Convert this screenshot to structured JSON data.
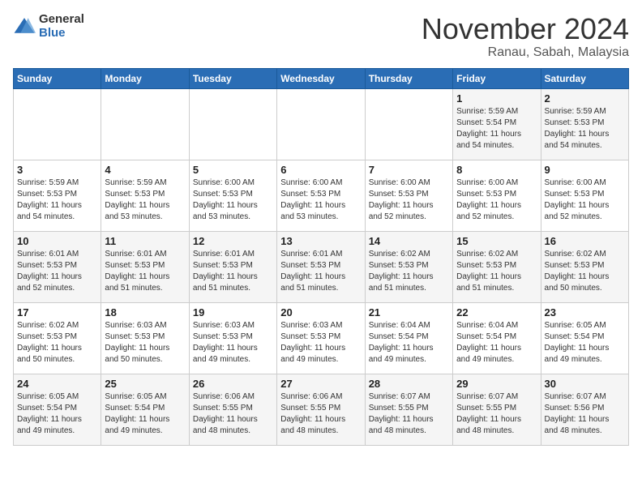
{
  "header": {
    "logo_general": "General",
    "logo_blue": "Blue",
    "month_title": "November 2024",
    "location": "Ranau, Sabah, Malaysia"
  },
  "days_of_week": [
    "Sunday",
    "Monday",
    "Tuesday",
    "Wednesday",
    "Thursday",
    "Friday",
    "Saturday"
  ],
  "weeks": [
    [
      {
        "day": "",
        "info": ""
      },
      {
        "day": "",
        "info": ""
      },
      {
        "day": "",
        "info": ""
      },
      {
        "day": "",
        "info": ""
      },
      {
        "day": "",
        "info": ""
      },
      {
        "day": "1",
        "info": "Sunrise: 5:59 AM\nSunset: 5:54 PM\nDaylight: 11 hours\nand 54 minutes."
      },
      {
        "day": "2",
        "info": "Sunrise: 5:59 AM\nSunset: 5:53 PM\nDaylight: 11 hours\nand 54 minutes."
      }
    ],
    [
      {
        "day": "3",
        "info": "Sunrise: 5:59 AM\nSunset: 5:53 PM\nDaylight: 11 hours\nand 54 minutes."
      },
      {
        "day": "4",
        "info": "Sunrise: 5:59 AM\nSunset: 5:53 PM\nDaylight: 11 hours\nand 53 minutes."
      },
      {
        "day": "5",
        "info": "Sunrise: 6:00 AM\nSunset: 5:53 PM\nDaylight: 11 hours\nand 53 minutes."
      },
      {
        "day": "6",
        "info": "Sunrise: 6:00 AM\nSunset: 5:53 PM\nDaylight: 11 hours\nand 53 minutes."
      },
      {
        "day": "7",
        "info": "Sunrise: 6:00 AM\nSunset: 5:53 PM\nDaylight: 11 hours\nand 52 minutes."
      },
      {
        "day": "8",
        "info": "Sunrise: 6:00 AM\nSunset: 5:53 PM\nDaylight: 11 hours\nand 52 minutes."
      },
      {
        "day": "9",
        "info": "Sunrise: 6:00 AM\nSunset: 5:53 PM\nDaylight: 11 hours\nand 52 minutes."
      }
    ],
    [
      {
        "day": "10",
        "info": "Sunrise: 6:01 AM\nSunset: 5:53 PM\nDaylight: 11 hours\nand 52 minutes."
      },
      {
        "day": "11",
        "info": "Sunrise: 6:01 AM\nSunset: 5:53 PM\nDaylight: 11 hours\nand 51 minutes."
      },
      {
        "day": "12",
        "info": "Sunrise: 6:01 AM\nSunset: 5:53 PM\nDaylight: 11 hours\nand 51 minutes."
      },
      {
        "day": "13",
        "info": "Sunrise: 6:01 AM\nSunset: 5:53 PM\nDaylight: 11 hours\nand 51 minutes."
      },
      {
        "day": "14",
        "info": "Sunrise: 6:02 AM\nSunset: 5:53 PM\nDaylight: 11 hours\nand 51 minutes."
      },
      {
        "day": "15",
        "info": "Sunrise: 6:02 AM\nSunset: 5:53 PM\nDaylight: 11 hours\nand 51 minutes."
      },
      {
        "day": "16",
        "info": "Sunrise: 6:02 AM\nSunset: 5:53 PM\nDaylight: 11 hours\nand 50 minutes."
      }
    ],
    [
      {
        "day": "17",
        "info": "Sunrise: 6:02 AM\nSunset: 5:53 PM\nDaylight: 11 hours\nand 50 minutes."
      },
      {
        "day": "18",
        "info": "Sunrise: 6:03 AM\nSunset: 5:53 PM\nDaylight: 11 hours\nand 50 minutes."
      },
      {
        "day": "19",
        "info": "Sunrise: 6:03 AM\nSunset: 5:53 PM\nDaylight: 11 hours\nand 49 minutes."
      },
      {
        "day": "20",
        "info": "Sunrise: 6:03 AM\nSunset: 5:53 PM\nDaylight: 11 hours\nand 49 minutes."
      },
      {
        "day": "21",
        "info": "Sunrise: 6:04 AM\nSunset: 5:54 PM\nDaylight: 11 hours\nand 49 minutes."
      },
      {
        "day": "22",
        "info": "Sunrise: 6:04 AM\nSunset: 5:54 PM\nDaylight: 11 hours\nand 49 minutes."
      },
      {
        "day": "23",
        "info": "Sunrise: 6:05 AM\nSunset: 5:54 PM\nDaylight: 11 hours\nand 49 minutes."
      }
    ],
    [
      {
        "day": "24",
        "info": "Sunrise: 6:05 AM\nSunset: 5:54 PM\nDaylight: 11 hours\nand 49 minutes."
      },
      {
        "day": "25",
        "info": "Sunrise: 6:05 AM\nSunset: 5:54 PM\nDaylight: 11 hours\nand 49 minutes."
      },
      {
        "day": "26",
        "info": "Sunrise: 6:06 AM\nSunset: 5:55 PM\nDaylight: 11 hours\nand 48 minutes."
      },
      {
        "day": "27",
        "info": "Sunrise: 6:06 AM\nSunset: 5:55 PM\nDaylight: 11 hours\nand 48 minutes."
      },
      {
        "day": "28",
        "info": "Sunrise: 6:07 AM\nSunset: 5:55 PM\nDaylight: 11 hours\nand 48 minutes."
      },
      {
        "day": "29",
        "info": "Sunrise: 6:07 AM\nSunset: 5:55 PM\nDaylight: 11 hours\nand 48 minutes."
      },
      {
        "day": "30",
        "info": "Sunrise: 6:07 AM\nSunset: 5:56 PM\nDaylight: 11 hours\nand 48 minutes."
      }
    ]
  ]
}
